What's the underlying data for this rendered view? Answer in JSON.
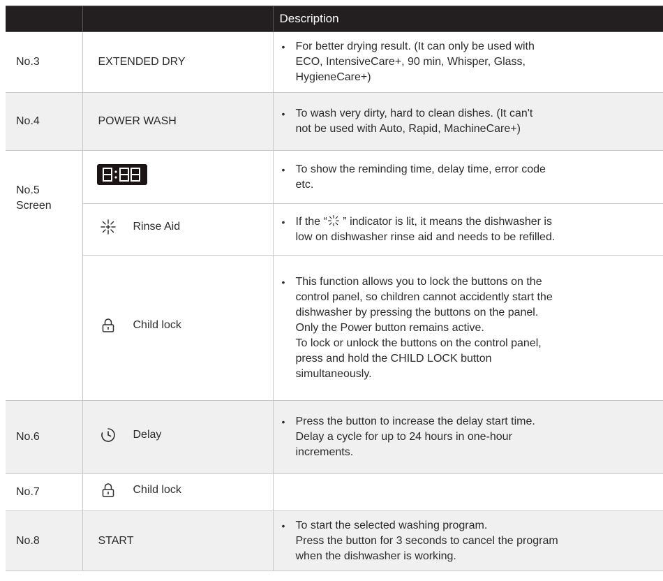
{
  "header": {
    "col1": "",
    "col2": "",
    "description": "Description"
  },
  "rows": [
    {
      "no": "No.3",
      "function": "EXTENDED DRY",
      "description": "For better drying result. (It can only be used with\nECO, IntensiveCare+, 90 min, Whisper, Glass,\nHygieneCare+)"
    },
    {
      "no": "No.4",
      "function": "POWER WASH",
      "description": "To wash very dirty, hard to clean dishes. (It can't\nnot be used with Auto, Rapid, MachineCare+)"
    },
    {
      "no_line1": "No.5",
      "no_line2": "Screen",
      "display_icon": "seven-segment-display",
      "display_text": "8:88",
      "display_description": "To show the reminding time, delay time, error code\n etc.",
      "rinse_icon": "sparkle-icon",
      "rinse_label": "Rinse Aid",
      "rinse_desc_before": "If the “",
      "rinse_desc_after": " ” indicator is lit, it means the dishwasher is\nlow on dishwasher rinse aid and needs to be refilled.",
      "lock_icon": "padlock-icon",
      "lock_label": "Child lock",
      "lock_description": "This function allows you to lock the buttons on the\ncontrol panel, so children cannot accidently start the\ndishwasher by pressing the buttons on the panel.\nOnly the Power button remains active.\nTo lock or unlock the buttons on the control panel,\npress and hold the CHILD LOCK button\nsimultaneously."
    },
    {
      "no": "No.6",
      "icon": "clock-icon",
      "function": "Delay",
      "description": "Press the button to increase the delay start time.\nDelay a cycle for up to 24 hours in one-hour\nincrements."
    },
    {
      "no": "No.7",
      "icon": "padlock-icon",
      "function": "Child lock",
      "description": ""
    },
    {
      "no": "No.8",
      "function": "START",
      "description": "To start the selected washing program.\nPress the button for 3 seconds to cancel the program\nwhen the dishwasher is working."
    }
  ],
  "bullet": "•",
  "colors": {
    "header_bg": "#231f20",
    "alt_row_bg": "#f0f0f0",
    "border": "#c9c9c9"
  }
}
